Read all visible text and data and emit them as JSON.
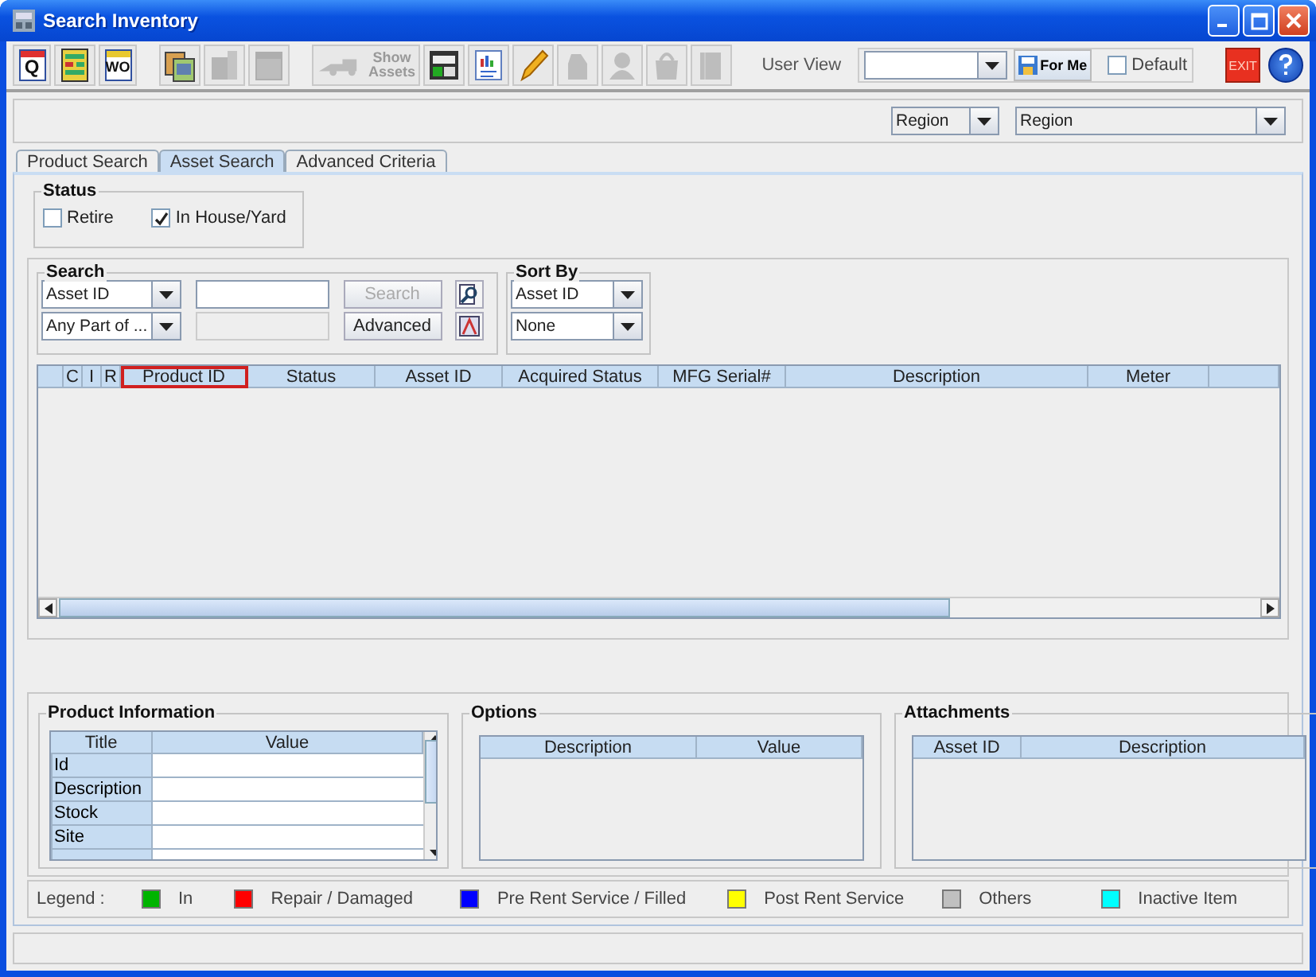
{
  "window": {
    "title": "Search Inventory"
  },
  "toolbar": [
    {
      "label": "Q",
      "disabled": false
    },
    {
      "disabled": false
    },
    {
      "label": "WO",
      "disabled": false
    },
    {
      "disabled": false
    },
    {
      "disabled": true
    },
    {
      "disabled": true
    },
    {
      "label": "Show Assets",
      "disabled": true
    },
    {
      "disabled": false
    },
    {
      "disabled": false
    },
    {
      "disabled": false
    },
    {
      "disabled": true
    },
    {
      "disabled": true
    },
    {
      "disabled": true
    },
    {
      "disabled": true
    }
  ],
  "user_view": {
    "label": "User View",
    "save_label": "For Me",
    "default": {
      "label": "Default",
      "checked": false
    }
  },
  "exit_label": "EXIT",
  "filters": [
    {
      "value": "Region"
    },
    {
      "value": "Region"
    }
  ],
  "tabs": [
    {
      "label": "Product Search",
      "selected": false
    },
    {
      "label": "Asset Search",
      "selected": true
    },
    {
      "label": "Advanced Criteria",
      "selected": false
    }
  ],
  "status_group": {
    "title": "Status",
    "options": [
      {
        "label": "Retire",
        "checked": false
      },
      {
        "label": "In House/Yard",
        "checked": true
      }
    ]
  },
  "search": {
    "title": "Search",
    "field": "Asset ID",
    "match": "Any Part of ...",
    "query_disabled": false,
    "second_disabled": true,
    "buttons": [
      {
        "label": "Search",
        "disabled": true
      },
      {
        "label": "Advanced",
        "disabled": false
      }
    ]
  },
  "sort_by": {
    "title": "Sort By",
    "primary": "Asset ID",
    "secondary": "None"
  },
  "results_table": {
    "columns": [
      {
        "label": "C",
        "selected": false
      },
      {
        "label": "I",
        "selected": false
      },
      {
        "label": "R",
        "selected": false
      },
      {
        "label": "Product ID",
        "selected": true
      },
      {
        "label": "Status",
        "selected": false
      },
      {
        "label": "Asset ID",
        "selected": false
      },
      {
        "label": "Acquired Status",
        "selected": false
      },
      {
        "label": "MFG Serial#",
        "selected": false
      },
      {
        "label": "Description",
        "selected": false
      },
      {
        "label": "Meter",
        "selected": false
      }
    ]
  },
  "product_information": {
    "title": "Product Information",
    "columns": [
      "Title",
      "Value"
    ],
    "rows": [
      "Id",
      "Description",
      "Stock",
      "Site"
    ]
  },
  "options": {
    "title": "Options",
    "columns": [
      "Description",
      "Value"
    ]
  },
  "attachments": {
    "title": "Attachments",
    "columns": [
      "Asset ID",
      "Description"
    ]
  },
  "legend": {
    "label": "Legend :",
    "items": [
      {
        "label": "In",
        "color": "#00b400"
      },
      {
        "label": "Repair / Damaged",
        "color": "#ff0000"
      },
      {
        "label": "Pre Rent Service / Filled",
        "color": "#0000ff"
      },
      {
        "label": "Post Rent Service",
        "color": "#ffff00"
      },
      {
        "label": "Others",
        "color": "#c0c0c0"
      },
      {
        "label": "Inactive Item",
        "color": "#00ffff"
      }
    ]
  }
}
